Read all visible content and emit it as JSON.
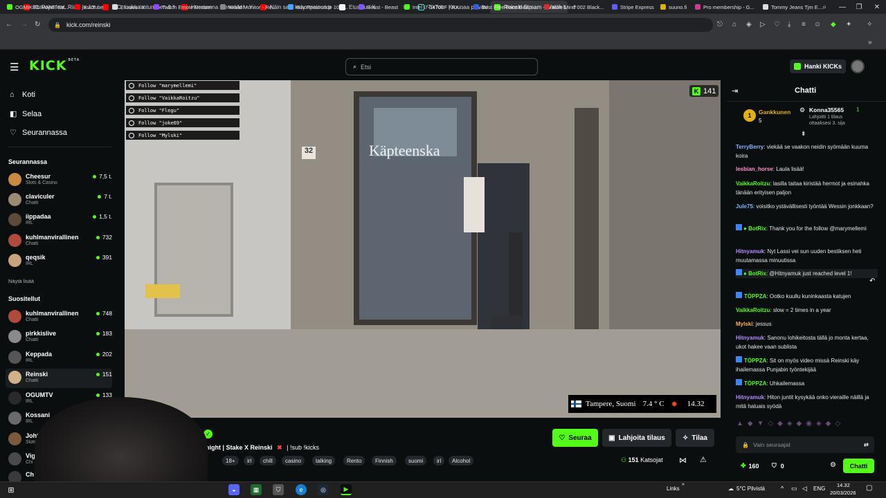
{
  "browser": {
    "tabs": [
      {
        "label": "XL Pojat feat. Riina ja Jon",
        "color": "#ff0000"
      },
      {
        "label": "IFC, loukkaantuminen & V",
        "color": "#ff0000"
      },
      {
        "label": "Huomenna mennään! - Y",
        "color": "#ff0000"
      },
      {
        "label": "Näin saat kehonpainon p",
        "color": "#ff0000"
      },
      {
        "label": "Etusivu / X",
        "color": "#ffffff"
      },
      {
        "label": "TikTok - Kruunaa päiväsi",
        "color": "#111111"
      },
      {
        "label": "Reinski Stream - Watch L",
        "color": "#53fc18"
      }
    ],
    "url": "kick.com/reinski",
    "bookmarks": [
      "OGMIKEDIMANE Str...",
      "YouTube",
      "Etusivu / X",
      "Twitch Emote Resizer",
      "World Monitor - Re...",
      "Buy Retatrutide 10m...",
      "Beast - Beast",
      "Intel i7-14700F | RX...",
      "Best Free Face Swap...",
      "Nike Mind 002 Black...",
      "Stripe Express",
      "suuno.fi",
      "Pro membership - G...",
      "Tommy Jeans Tjm E..."
    ]
  },
  "kick": {
    "logo": "KICK",
    "beta": "BETA",
    "search_placeholder": "Etsi",
    "hanki_label": "Hanki KICKs",
    "nav": [
      {
        "label": "Koti",
        "icon": "home-icon",
        "glyph": "⌂"
      },
      {
        "label": "Selaa",
        "icon": "browse-icon",
        "glyph": "◧"
      },
      {
        "label": "Seurannassa",
        "icon": "heart-icon",
        "glyph": "♡"
      }
    ],
    "following_title": "Seurannassa",
    "following": [
      {
        "name": "Cheesur",
        "cat": "Slots & Casino",
        "viewers": "7,5 t.",
        "color": "#c98a3c"
      },
      {
        "name": "claviculer",
        "cat": "Chatti",
        "viewers": "7 t.",
        "color": "#9b8b73"
      },
      {
        "name": "iippadaa",
        "cat": "IRL",
        "viewers": "1,5 t.",
        "color": "#5c4a3a"
      },
      {
        "name": "kuhlmanvirallinen",
        "cat": "Chatti",
        "viewers": "732",
        "color": "#b04a3b"
      },
      {
        "name": "qeqsik",
        "cat": "IRL",
        "viewers": "391",
        "color": "#c9a37c"
      }
    ],
    "show_more": "Näytä lisää",
    "recommended_title": "Suositellut",
    "recommended": [
      {
        "name": "kuhlmanvirallinen",
        "cat": "Chatti",
        "viewers": "748",
        "color": "#b04a3b"
      },
      {
        "name": "pirkkislive",
        "cat": "Chatti",
        "viewers": "183",
        "color": "#8a8a8a"
      },
      {
        "name": "Keppada",
        "cat": "IRL",
        "viewers": "202",
        "color": "#555555"
      },
      {
        "name": "Reinski",
        "cat": "Chatti",
        "viewers": "151",
        "color": "#d2b08a"
      },
      {
        "name": "OGUMTV",
        "cat": "IRL",
        "viewers": "133",
        "color": "#2a2a2a"
      },
      {
        "name": "Kossani",
        "cat": "IRL",
        "viewers": "",
        "color": "#6a6a6a"
      },
      {
        "name": "Johtaj",
        "cat": "Slots",
        "viewers": "",
        "color": "#7a5a3a"
      },
      {
        "name": "Vigi",
        "cat": "Chi",
        "viewers": "",
        "color": "#4a4a4a"
      },
      {
        "name": "Ch",
        "cat": "",
        "viewers": "",
        "color": "#3a3a3a"
      }
    ],
    "stream": {
      "follow_alerts": [
        "Follow \"marymellemi\"",
        "Follow \"VaikkaRoitzu\"",
        "Follow \"Flegu\"",
        "Follow \"joke69\"",
        "Follow \"Mylski\""
      ],
      "viewer_count": "141",
      "shop_sign": "Käpteenska",
      "door_number": "32",
      "weather_location": "Tampere, Suomi",
      "weather_temp": "7.4 ° C",
      "weather_time": "14.32",
      "title_suffix": "night | Stake X Reinski",
      "title_extra": "| !sub !kicks",
      "tags": [
        "18+",
        "irl",
        "chill",
        "casino",
        "talking",
        "Rento",
        "Finnish",
        "suomi",
        "irl",
        "Alcohol"
      ],
      "viewers_label": "151",
      "viewers_word": "Katsojat",
      "follow_button": "Seuraa",
      "gift_button": "Lahjoita tilaus",
      "sub_button": "Tilaa"
    },
    "chat": {
      "title": "Chatti",
      "top_gifter": {
        "name": "Gankkunen",
        "count": "5"
      },
      "gift_user": {
        "name": "Konna35565",
        "count": "1",
        "line1": "Lahjoitti 1 tilaus",
        "line2": "ottaaksesi 3. sija"
      },
      "messages": [
        {
          "user": "TerryBerry",
          "color": "#7fb5ff",
          "text": "viekää se vaakon neidin syömään kuuma koira"
        },
        {
          "user": "lesbian_horse",
          "color": "#ff8fd0",
          "text": "Laula lisää!"
        },
        {
          "user": "VaikkaRoitzu",
          "color": "#53fc18",
          "text": "lasilla taitaa kiristää hermot ja esinahka tänään erityisen paljon"
        },
        {
          "user": "Jule75",
          "color": "#7fb5ff",
          "text": "voisitko ystävällisesti työntää Wessin jonkkaan?"
        },
        {
          "user": "BotRix",
          "color": "#53fc18",
          "text": "Thank you for the follow @marymellemi"
        },
        {
          "user": "Hitnyamuk",
          "color": "#b58cff",
          "text": "Nyt Lassi vei sun uuden bestiksen heti muutamassa minuutissa"
        },
        {
          "user": "BotRix",
          "color": "#53fc18",
          "text": "@Hitnyamuk just reached level 1!"
        },
        {
          "user": "TÖPPZA",
          "color": "#53fc18",
          "text": "Ootko kuullu kuninkaasta katujen"
        },
        {
          "user": "VaikkaRoitzu",
          "color": "#53fc18",
          "text": "slow = 2 times in a year"
        },
        {
          "user": "Mylski",
          "color": "#ffb347",
          "text": "jessus"
        },
        {
          "user": "Hitnyamuk",
          "color": "#b58cff",
          "text": "Sanonu lohikeitosta tällä jo monta kertaa, ukot hakee vaan sublista"
        },
        {
          "user": "TÖPPZA",
          "color": "#53fc18",
          "text": "Sit on myös video missä Reinski käy ihailemassa Punjabin työntekijää"
        },
        {
          "user": "TÖPPZA",
          "color": "#53fc18",
          "text": "Uhkailemassa"
        },
        {
          "user": "Hitnyamuk",
          "color": "#b58cff",
          "text": "Hiton juntit kysykää onko vieraille näillä ja mitä haluais syödä"
        }
      ],
      "input_placeholder": "Vain seuraajat",
      "points": "160",
      "kicks": "0",
      "send_button": "Chatti"
    }
  },
  "taskbar": {
    "links": "Links",
    "weather": "5°C  Pilvistä",
    "lang": "ENG",
    "time": "14.32",
    "date": "20/03/2026"
  }
}
